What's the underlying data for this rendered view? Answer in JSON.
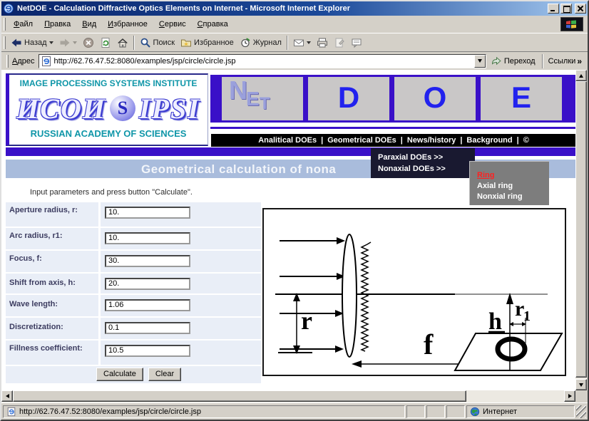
{
  "window": {
    "title": "NetDOE - Calculation Diffractive Optics Elements on Internet - Microsoft Internet Explorer"
  },
  "menu": {
    "items": [
      "Файл",
      "Правка",
      "Вид",
      "Избранное",
      "Сервис",
      "Справка"
    ]
  },
  "toolbar": {
    "back": "Назад",
    "search": "Поиск",
    "favorites": "Избранное",
    "history": "Журнал"
  },
  "address": {
    "label": "Адрес",
    "url": "http://62.76.47.52:8080/examples/jsp/circle/circle.jsp",
    "go": "Переход",
    "links": "Ссылки",
    "chevron": "»"
  },
  "header": {
    "institute": "IMAGE PROCESSING SYSTEMS INSTITUTE",
    "logo_cyrillic": "ИСОИ",
    "logo_s": "S",
    "logo_latin": "IPSI",
    "academy": "RUSSIAN ACADEMY OF SCIENCES",
    "net_n": "N",
    "net_e": "E",
    "net_t": "T",
    "doe_d": "D",
    "doe_o": "O",
    "doe_e": "E"
  },
  "nav": {
    "separator": "|",
    "items": [
      "Analitical DOEs",
      "Geometrical DOEs",
      "News/history",
      "Background",
      "©"
    ]
  },
  "doe_menu": {
    "items": [
      "Paraxial DOEs >>",
      "Nonaxial DOEs >>"
    ]
  },
  "ring_menu": {
    "items": [
      "Ring",
      "Axial ring",
      "Nonxial ring"
    ]
  },
  "page": {
    "title": "Geometrical calculation of nona",
    "instruction": "Input parameters and press button \"Calculate\".",
    "form": {
      "fields": [
        {
          "label": "Aperture radius, r:",
          "value": "10."
        },
        {
          "label": "Arc radius, r1:",
          "value": "10."
        },
        {
          "label": "Focus, f:",
          "value": "30."
        },
        {
          "label": "Shift from axis, h:",
          "value": "20."
        },
        {
          "label": "Wave length:",
          "value": "1.06"
        },
        {
          "label": "Discretization:",
          "value": "0.1"
        },
        {
          "label": "Fillness coefficient:",
          "value": "10.5"
        }
      ],
      "calculate": "Calculate",
      "clear": "Clear"
    },
    "diagram": {
      "r": "r",
      "f": "f",
      "h": "h",
      "r1": "r",
      "r1_sub": "1"
    }
  },
  "status": {
    "text": "http://62.76.47.52:8080/examples/jsp/circle/circle.jsp",
    "zone": "Интернет"
  },
  "colors": {
    "accent_purple": "#3a10c8",
    "banner_bg": "#a9bcdc",
    "banner_text": "#f2f5fa",
    "nav_bg": "#000000",
    "row_bg": "#e9eef7",
    "link_red": "#ff2020",
    "doe_blue": "#2222ee",
    "teal": "#0f96a8"
  }
}
